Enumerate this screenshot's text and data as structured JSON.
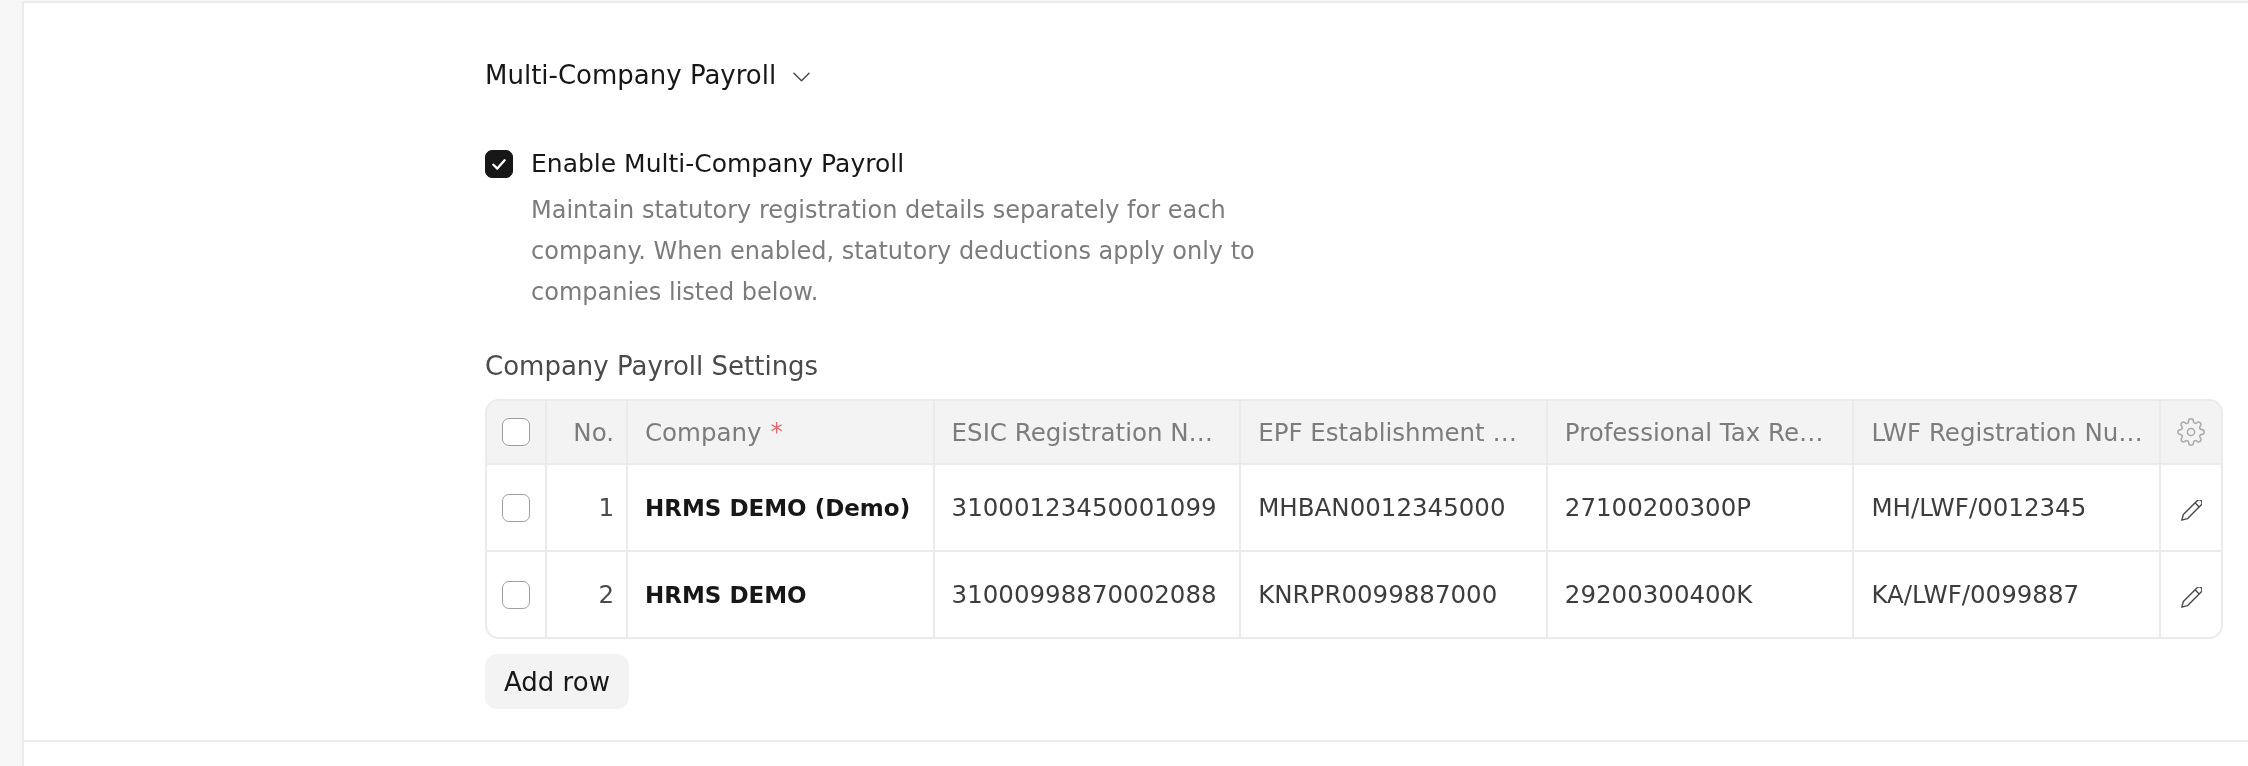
{
  "section": {
    "title": "Multi-Company Payroll",
    "expanded": true
  },
  "enable_field": {
    "label": "Enable Multi-Company Payroll",
    "checked": true,
    "description": "Maintain statutory registration details separately for each company. When enabled, statutory deductions apply only to companies listed below."
  },
  "table": {
    "label": "Company Payroll Settings",
    "select_all": {
      "checked": false
    },
    "columns": [
      {
        "label": "No.",
        "kind": "index"
      },
      {
        "label": "Company",
        "kind": "link",
        "required_mark": "*"
      },
      {
        "label": "ESIC Registration N…",
        "kind": "data"
      },
      {
        "label": "EPF Establishment …",
        "kind": "data"
      },
      {
        "label": "Professional Tax Re…",
        "kind": "data"
      },
      {
        "label": "LWF Registration Nu…",
        "kind": "data"
      }
    ],
    "rows": [
      {
        "selected": false,
        "cells": [
          "1",
          "HRMS DEMO (Demo)",
          "31000123450001099",
          "MHBAN0012345000",
          "27100200300P",
          "MH/LWF/0012345"
        ]
      },
      {
        "selected": false,
        "cells": [
          "2",
          "HRMS DEMO",
          "31000998870002088",
          "KNRPR0099887000",
          "29200300400K",
          "KA/LWF/0099887"
        ]
      }
    ],
    "add_row_button": {
      "label": "Add row"
    }
  }
}
